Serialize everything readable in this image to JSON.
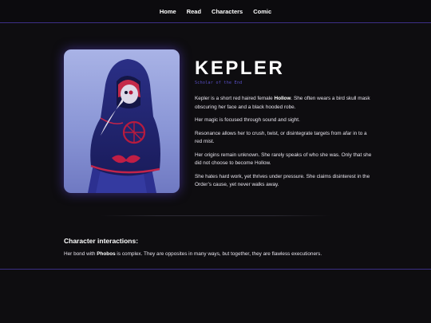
{
  "nav": {
    "items": [
      {
        "label": "Home"
      },
      {
        "label": "Read"
      },
      {
        "label": "Characters"
      },
      {
        "label": "Comic"
      }
    ]
  },
  "character": {
    "name": "KEPLER",
    "subtitle": "Scholar of the End",
    "bio": {
      "p1_before": "Kepler is a short red haired female ",
      "p1_bold": "Hollow",
      "p1_after": ". She often wears a bird skull mask obscuring her face and a black hooded robe.",
      "p2": "Her magic is focused through sound and sight.",
      "p3": "Resonance allows her to crush, twist, or disintegrate targets from afar in to a red mist.",
      "p4": "Her origins remain unknown. She rarely speaks of who she was. Only that she did not choose to become Hollow.",
      "p5": "She hates hard work, yet thrives under pressure. She claims disinterest in the Order’s cause, yet never walks away."
    }
  },
  "interactions": {
    "title": "Character interactions:",
    "text_before": "Her bond with ",
    "text_bold": "Phobos",
    "text_after": " is complex. They are opposites in many ways, but together, they are flawless executioners."
  },
  "colors": {
    "accent": "#3c2f86",
    "subtitle": "#5a50c8",
    "background": "#0e0d10"
  }
}
